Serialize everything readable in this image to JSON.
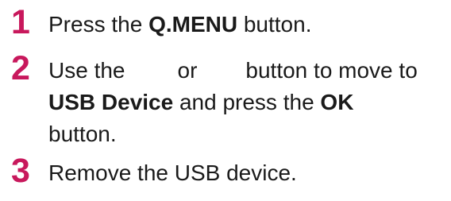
{
  "steps": [
    {
      "number": "1",
      "parts": {
        "pre": "Press the ",
        "bold": "Q.MENU",
        "post": " button."
      }
    },
    {
      "number": "2",
      "line1": {
        "use_the": "Use the",
        "or": "or",
        "rest": "button to move to"
      },
      "line2": {
        "bold1": "USB Device",
        "mid": " and press the ",
        "bold2": "OK"
      },
      "line3": "button."
    },
    {
      "number": "3",
      "text": "Remove the USB device."
    }
  ]
}
